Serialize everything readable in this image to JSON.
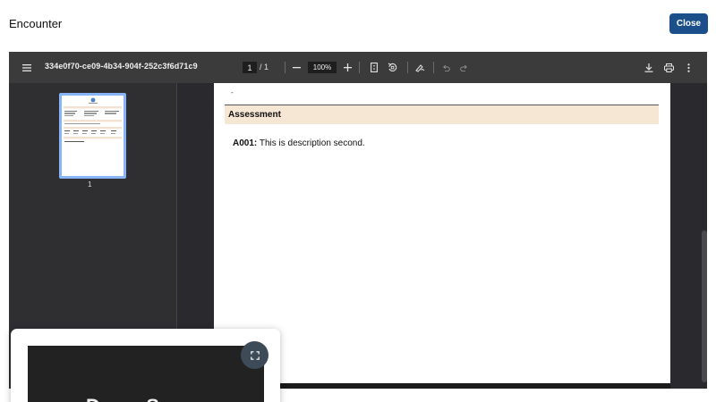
{
  "header": {
    "title": "Encounter",
    "close_label": "Close"
  },
  "toolbar": {
    "menu_icon": "menu-icon",
    "filename": "334e0f70-ce09-4b34-904f-252c3f6d71c9",
    "current_page": "1",
    "page_total": "/ 1",
    "zoom_out_icon": "minus-icon",
    "zoom_level": "100%",
    "zoom_in_icon": "plus-icon",
    "fit_page_icon": "fit-page-icon",
    "rotate_icon": "rotate-icon",
    "annotate_icon": "draw-icon",
    "undo_icon": "undo-icon",
    "redo_icon": "redo-icon",
    "download_icon": "download-icon",
    "print_icon": "print-icon",
    "more_icon": "more-vert-icon"
  },
  "sidebar": {
    "thumbnails": [
      {
        "page_number": "1"
      }
    ]
  },
  "document": {
    "dash": "-",
    "section_title": "Assessment",
    "assessment": {
      "code": "A001:",
      "description": " This is description second."
    }
  },
  "pip": {
    "preview_text": "Demo Ser",
    "expand_icon": "fullscreen-icon"
  },
  "colors": {
    "close_button": "#1b4f8a",
    "toolbar_bg": "#3b3b3b",
    "viewer_bg": "#2a2a2e",
    "section_head_bg": "#f6e6d4",
    "thumbnail_border": "#8ab4f8"
  }
}
